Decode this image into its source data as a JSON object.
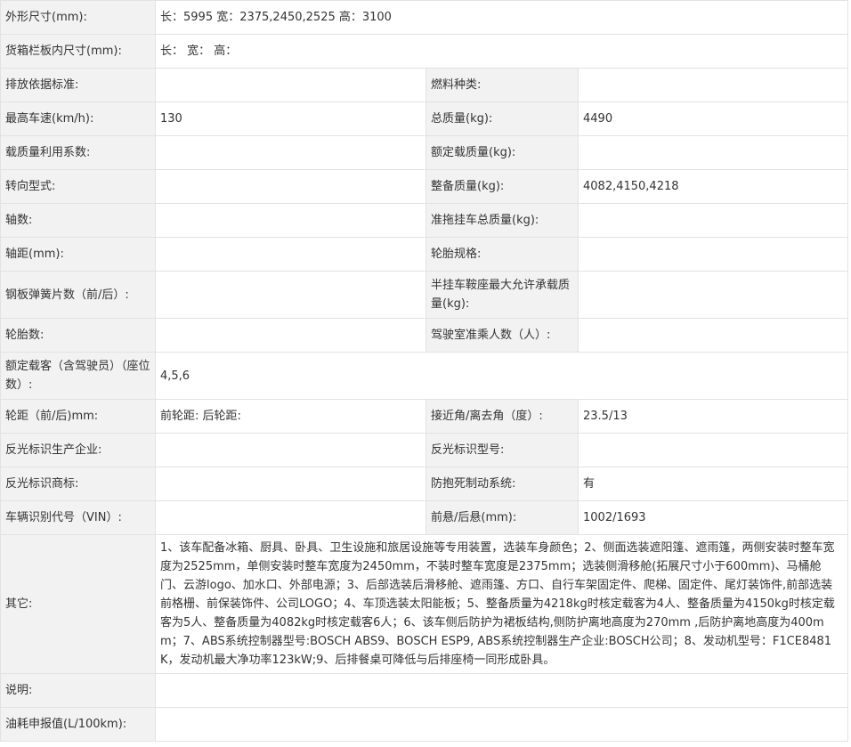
{
  "rows": {
    "dimensions": {
      "label": "外形尺寸(mm):",
      "value": "长：5995 宽：2375,2450,2525 高：3100"
    },
    "cargo_box": {
      "label": "货箱栏板内尺寸(mm):",
      "value": "长： 宽： 高："
    },
    "emission_standard": {
      "label": "排放依据标准:",
      "value": ""
    },
    "fuel_type": {
      "label": "燃料种类:",
      "value": ""
    },
    "max_speed": {
      "label": "最高车速(km/h):",
      "value": "130"
    },
    "total_mass": {
      "label": "总质量(kg):",
      "value": "4490"
    },
    "load_factor": {
      "label": "载质量利用系数:",
      "value": ""
    },
    "rated_load": {
      "label": "额定载质量(kg):",
      "value": ""
    },
    "steering": {
      "label": "转向型式:",
      "value": ""
    },
    "curb_mass": {
      "label": "整备质量(kg):",
      "value": "4082,4150,4218"
    },
    "axles": {
      "label": "轴数:",
      "value": ""
    },
    "trailer_mass": {
      "label": "准拖挂车总质量(kg):",
      "value": ""
    },
    "wheelbase": {
      "label": "轴距(mm):",
      "value": ""
    },
    "tire_spec": {
      "label": "轮胎规格:",
      "value": ""
    },
    "leaf_springs": {
      "label": "钢板弹簧片数（前/后）:",
      "value": ""
    },
    "saddle_load": {
      "label": "半挂车鞍座最大允许承载质量(kg):",
      "value": ""
    },
    "tire_count": {
      "label": "轮胎数:",
      "value": ""
    },
    "cab_occupants": {
      "label": "驾驶室准乘人数（人）:",
      "value": ""
    },
    "rated_passengers": {
      "label": "额定载客（含驾驶员）（座位数）:",
      "value": "4,5,6"
    },
    "track": {
      "label": "轮距（前/后)mm:",
      "value": "前轮距: 后轮距:"
    },
    "approach_angle": {
      "label": "接近角/离去角（度）:",
      "value": "23.5/13"
    },
    "reflector_maker": {
      "label": "反光标识生产企业:",
      "value": ""
    },
    "reflector_model": {
      "label": "反光标识型号:",
      "value": ""
    },
    "reflector_brand": {
      "label": "反光标识商标:",
      "value": ""
    },
    "abs": {
      "label": "防抱死制动系统:",
      "value": "有"
    },
    "vin": {
      "label": "车辆识别代号（VIN）:",
      "value": ""
    },
    "overhang": {
      "label": "前悬/后悬(mm):",
      "value": "1002/1693"
    },
    "other": {
      "label": "其它:",
      "value": "1、该车配备冰箱、厨具、卧具、卫生设施和旅居设施等专用装置，选装车身颜色；2、侧面选装遮阳篷、遮雨篷，两侧安装时整车宽度为2525mm，单侧安装时整车宽度为2450mm，不装时整车宽度是2375mm；选装侧滑移舱(拓展尺寸小于600mm)、马桶舱门、云游logo、加水口、外部电源；3、后部选装后滑移舱、遮雨篷、方口、自行车架固定件、爬梯、固定件、尾灯装饰件,前部选装前格栅、前保装饰件、公司LOGO；4、车顶选装太阳能板；5、整备质量为4218kg时核定载客为4人、整备质量为4150kg时核定载客为5人、整备质量为4082kg时核定载客6人；6、该车侧后防护为裙板结构,侧防护离地高度为270mm ,后防护离地高度为400mm；7、ABS系统控制器型号:BOSCH ABS9、BOSCH ESP9, ABS系统控制器生产企业:BOSCH公司；8、发动机型号：F1CE8481K，发动机最大净功率123kW;9、后排餐桌可降低与后排座椅一同形成卧具。"
    },
    "notes": {
      "label": "说明:",
      "value": ""
    },
    "fuel_consumption": {
      "label": "油耗申报值(L/100km):",
      "value": ""
    }
  }
}
